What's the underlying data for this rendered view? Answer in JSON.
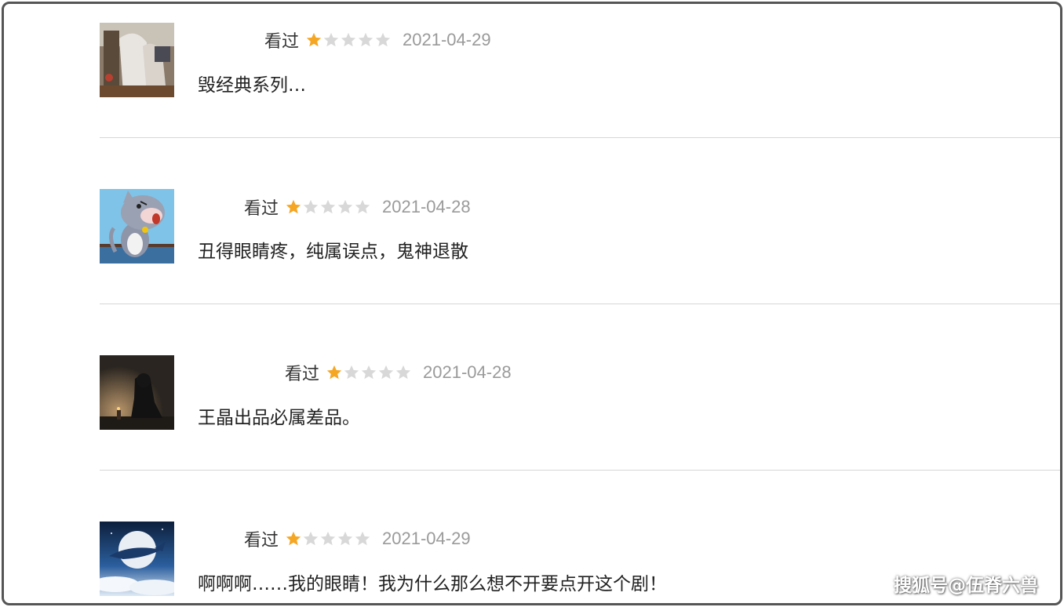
{
  "reviews": [
    {
      "status": "看过",
      "rating": 1,
      "rating_max": 5,
      "date": "2021-04-29",
      "content": "毁经典系列…",
      "avatar": "photo-avatar"
    },
    {
      "status": "看过",
      "rating": 1,
      "rating_max": 5,
      "date": "2021-04-28",
      "content": "丑得眼睛疼，纯属误点，鬼神退散",
      "avatar": "cartoon-cat-avatar"
    },
    {
      "status": "看过",
      "rating": 1,
      "rating_max": 5,
      "date": "2021-04-28",
      "content": "王晶出品必属差品。",
      "avatar": "dark-figure-avatar"
    },
    {
      "status": "看过",
      "rating": 1,
      "rating_max": 5,
      "date": "2021-04-29",
      "content": "啊啊啊……我的眼睛！我为什么那么想不开要点开这个剧！",
      "avatar": "whale-moon-avatar"
    }
  ],
  "watermark": "搜狐号@伍脊六兽",
  "colors": {
    "star_filled": "#f5a623",
    "star_empty": "#d8d8d8",
    "date": "#9a9a9a",
    "divider": "#d6d6d6",
    "frame_border": "#555555"
  },
  "icons": {
    "star_filled": "star-filled-icon",
    "star_empty": "star-empty-icon"
  }
}
